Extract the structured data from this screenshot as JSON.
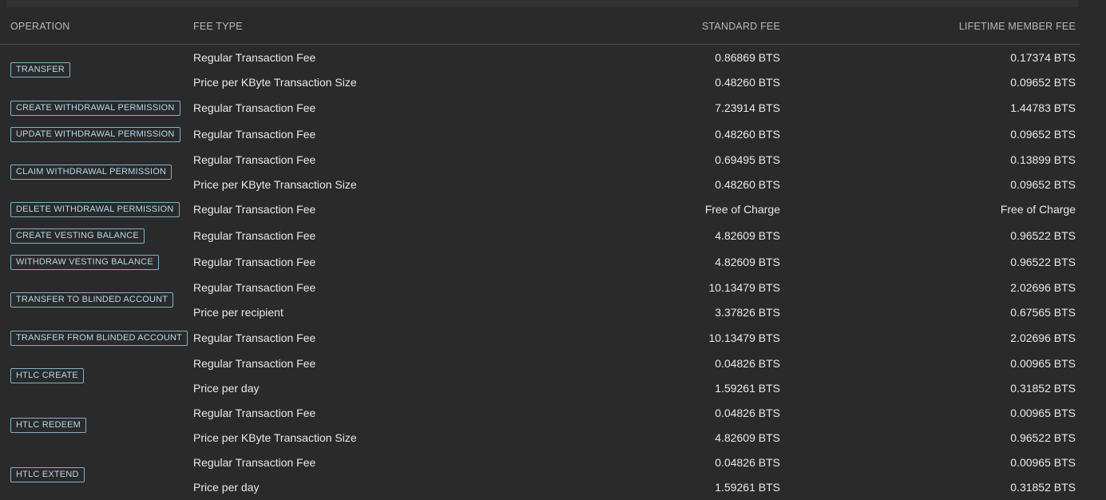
{
  "headers": {
    "operation": "OPERATION",
    "fee_type": "FEE TYPE",
    "standard_fee": "STANDARD FEE",
    "lifetime_member_fee": "LIFETIME MEMBER FEE"
  },
  "operations": [
    {
      "label": "TRANSFER",
      "fees": [
        {
          "type": "Regular Transaction Fee",
          "standard": "0.86869 BTS",
          "lifetime": "0.17374 BTS"
        },
        {
          "type": "Price per KByte Transaction Size",
          "standard": "0.48260 BTS",
          "lifetime": "0.09652 BTS"
        }
      ]
    },
    {
      "label": "CREATE WITHDRAWAL PERMISSION",
      "fees": [
        {
          "type": "Regular Transaction Fee",
          "standard": "7.23914 BTS",
          "lifetime": "1.44783 BTS"
        }
      ]
    },
    {
      "label": "UPDATE WITHDRAWAL PERMISSION",
      "fees": [
        {
          "type": "Regular Transaction Fee",
          "standard": "0.48260 BTS",
          "lifetime": "0.09652 BTS"
        }
      ]
    },
    {
      "label": "CLAIM WITHDRAWAL PERMISSION",
      "fees": [
        {
          "type": "Regular Transaction Fee",
          "standard": "0.69495 BTS",
          "lifetime": "0.13899 BTS"
        },
        {
          "type": "Price per KByte Transaction Size",
          "standard": "0.48260 BTS",
          "lifetime": "0.09652 BTS"
        }
      ]
    },
    {
      "label": "DELETE WITHDRAWAL PERMISSION",
      "fees": [
        {
          "type": "Regular Transaction Fee",
          "standard": "Free of Charge",
          "lifetime": "Free of Charge"
        }
      ]
    },
    {
      "label": "CREATE VESTING BALANCE",
      "fees": [
        {
          "type": "Regular Transaction Fee",
          "standard": "4.82609 BTS",
          "lifetime": "0.96522 BTS"
        }
      ]
    },
    {
      "label": "WITHDRAW VESTING BALANCE",
      "fees": [
        {
          "type": "Regular Transaction Fee",
          "standard": "4.82609 BTS",
          "lifetime": "0.96522 BTS"
        }
      ]
    },
    {
      "label": "TRANSFER TO BLINDED ACCOUNT",
      "fees": [
        {
          "type": "Regular Transaction Fee",
          "standard": "10.13479 BTS",
          "lifetime": "2.02696 BTS"
        },
        {
          "type": "Price per recipient",
          "standard": "3.37826 BTS",
          "lifetime": "0.67565 BTS"
        }
      ]
    },
    {
      "label": "TRANSFER FROM BLINDED ACCOUNT",
      "fees": [
        {
          "type": "Regular Transaction Fee",
          "standard": "10.13479 BTS",
          "lifetime": "2.02696 BTS"
        }
      ]
    },
    {
      "label": "HTLC CREATE",
      "fees": [
        {
          "type": "Regular Transaction Fee",
          "standard": "0.04826 BTS",
          "lifetime": "0.00965 BTS"
        },
        {
          "type": "Price per day",
          "standard": "1.59261 BTS",
          "lifetime": "0.31852 BTS"
        }
      ]
    },
    {
      "label": "HTLC REDEEM",
      "fees": [
        {
          "type": "Regular Transaction Fee",
          "standard": "0.04826 BTS",
          "lifetime": "0.00965 BTS"
        },
        {
          "type": "Price per KByte Transaction Size",
          "standard": "4.82609 BTS",
          "lifetime": "0.96522 BTS"
        }
      ]
    },
    {
      "label": "HTLC EXTEND",
      "fees": [
        {
          "type": "Regular Transaction Fee",
          "standard": "0.04826 BTS",
          "lifetime": "0.00965 BTS"
        },
        {
          "type": "Price per day",
          "standard": "1.59261 BTS",
          "lifetime": "0.31852 BTS"
        }
      ]
    }
  ]
}
